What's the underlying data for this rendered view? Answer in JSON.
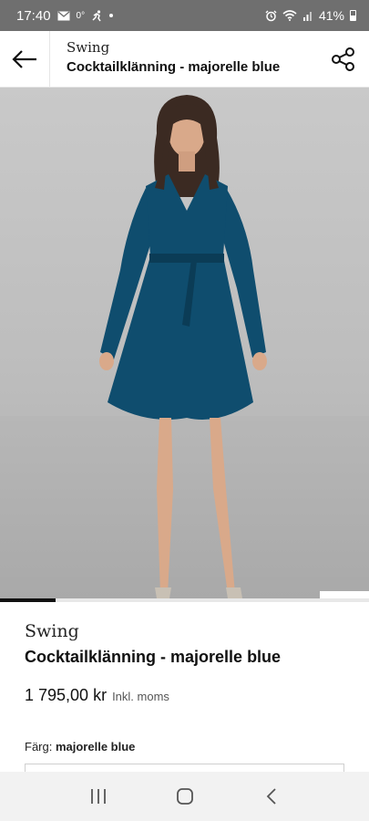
{
  "status_bar": {
    "time": "17:40",
    "temp": "0°",
    "battery": "41%"
  },
  "header": {
    "brand": "Swing",
    "product": "Cocktailklänning - majorelle blue"
  },
  "gallery": {
    "progress_fraction": 0.15
  },
  "product": {
    "brand": "Swing",
    "name": "Cocktailklänning - majorelle blue",
    "price": "1 795,00 kr",
    "vat_note": "Inkl. moms",
    "color_label": "Färg:",
    "color_value": "majorelle blue"
  },
  "colors": {
    "dress": "#0f4d6e",
    "status_bar": "#6f6f6f",
    "nav_bar": "#f2f2f2"
  },
  "icons": {
    "back": "arrow-left-icon",
    "share": "share-icon",
    "similar": "similar-items-icon",
    "wishlist": "heart-icon",
    "bag": "shopping-bag-icon"
  }
}
